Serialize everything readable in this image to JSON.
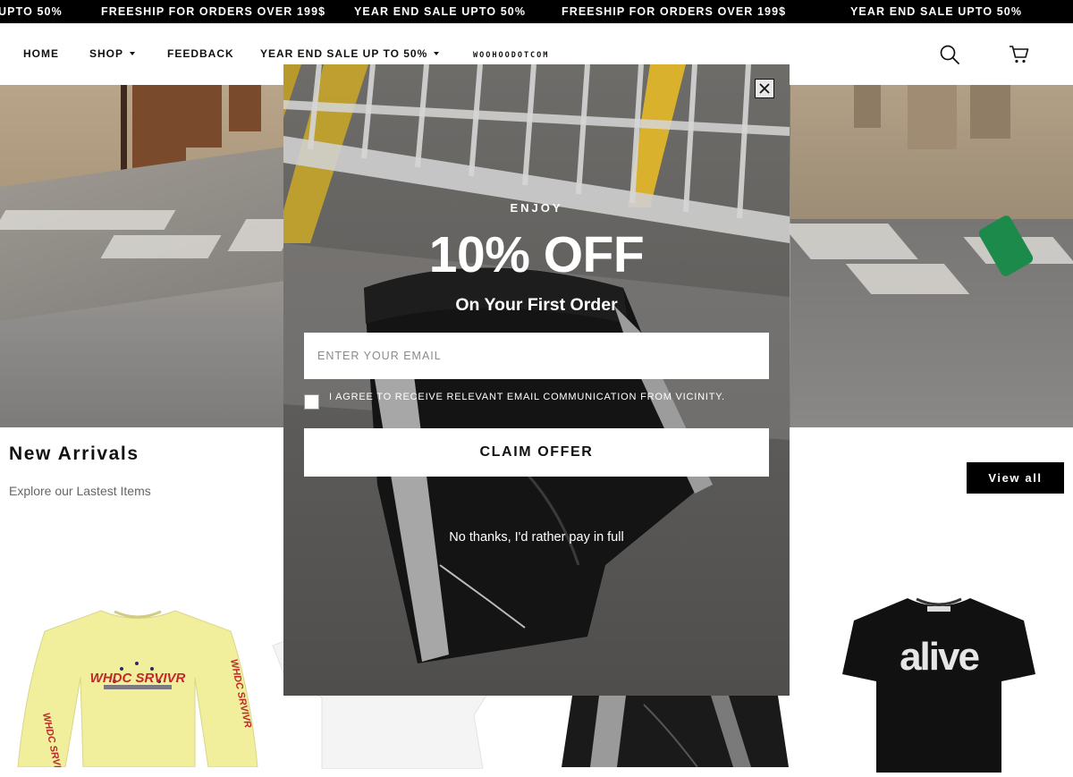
{
  "announcement": {
    "items": [
      "UPTO 50%",
      "FREESHIP FOR ORDERS OVER 199$",
      "YEAR END SALE UPTO 50%",
      "FREESHIP FOR ORDERS OVER 199$",
      "YEAR END SALE UPTO 50%"
    ]
  },
  "header": {
    "nav": [
      {
        "label": "HOME",
        "has_dropdown": false
      },
      {
        "label": "SHOP",
        "has_dropdown": true
      },
      {
        "label": "FEEDBACK",
        "has_dropdown": false
      },
      {
        "label": "YEAR END SALE UP TO 50%",
        "has_dropdown": true
      }
    ],
    "logo_text": "WOOHOODOTCOM",
    "icons": [
      "search-icon",
      "cart-icon"
    ]
  },
  "section": {
    "title": "New Arrivals",
    "subtitle": "Explore our Lastest Items",
    "view_all_label": "View all"
  },
  "products": [
    {
      "print_text": "WHDC SRVIVR"
    },
    {
      "print_text": ""
    },
    {
      "print_text": ""
    },
    {
      "print_text": "alive"
    }
  ],
  "modal": {
    "eyebrow": "ENJOY",
    "headline": "10% OFF",
    "subheadline": "On Your First Order",
    "email_placeholder": "ENTER YOUR EMAIL",
    "consent_text": "I AGREE TO RECEIVE RELEVANT EMAIL COMMUNICATION FROM VICINITY.",
    "consent_checked": false,
    "claim_label": "CLAIM OFFER",
    "decline_label": "No thanks, I'd rather pay in full",
    "close_icon": "close-icon"
  },
  "colors": {
    "announcement_bg": "#000000",
    "button_bg": "#000000",
    "modal_text": "#ffffff"
  }
}
